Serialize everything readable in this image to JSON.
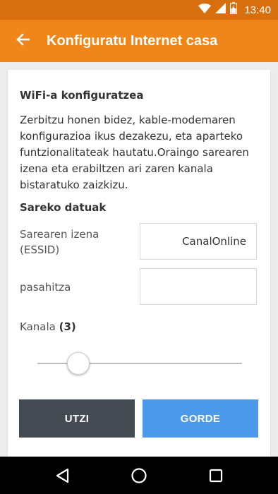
{
  "status_bar": {
    "time": "13:40",
    "icons": [
      "wifi-icon",
      "signal-icon",
      "battery-icon"
    ]
  },
  "app_bar": {
    "title": "Konfiguratu Internet casa",
    "back_icon": "arrow-left-icon",
    "color": "#f0861a"
  },
  "wifi_section": {
    "title": "WiFi-a konfiguratzea",
    "description": "Zerbitzu honen bidez, kable-modemaren konfigurazioa ikus dezakezu, eta aparteko funtzionalitateak hautatu.Oraingo sarearen izena eta erabiltzen ari zaren kanala bistaratuko zaizkizu."
  },
  "network_data": {
    "title": "Sareko datuak",
    "ssid_label_line1": "Sarearen izena",
    "ssid_label_line2": "(ESSID)",
    "ssid_value": "CanalOnline",
    "password_label": "pasahitza",
    "password_value": ""
  },
  "channel": {
    "label": "Kanala",
    "value_text": "(3)",
    "value": 3
  },
  "buttons": {
    "cancel_label": "UTZI",
    "save_label": "GORDE",
    "cancel_color": "#444b52",
    "save_color": "#4c9aeb"
  },
  "nav_bar": {
    "icons": [
      "back-triangle-icon",
      "home-circle-icon",
      "recents-square-icon"
    ]
  }
}
